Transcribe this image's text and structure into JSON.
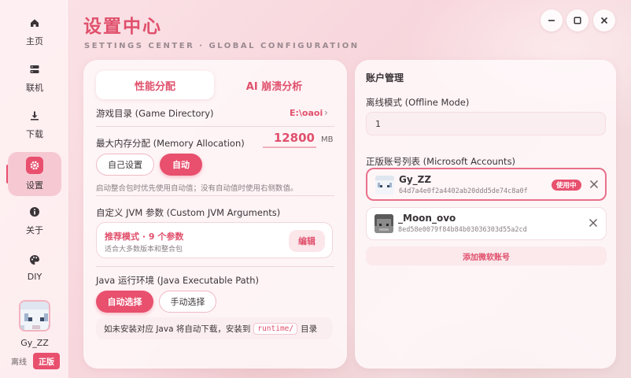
{
  "app": {
    "title": "设置中心",
    "subtitle": "SETTINGS CENTER · GLOBAL CONFIGURATION"
  },
  "sidebar": {
    "items": [
      {
        "label": "主页",
        "icon": "home-icon"
      },
      {
        "label": "联机",
        "icon": "server-icon"
      },
      {
        "label": "下载",
        "icon": "download-icon"
      },
      {
        "label": "设置",
        "icon": "gear-icon",
        "active": true
      },
      {
        "label": "关于",
        "icon": "info-icon"
      },
      {
        "label": "DIY",
        "icon": "palette-icon"
      }
    ],
    "user": {
      "name": "Gy_ZZ",
      "mode_offline": "离线",
      "mode_online": "正版"
    }
  },
  "left": {
    "tabs": [
      {
        "label": "性能分配",
        "active": true
      },
      {
        "label": "AI 崩溃分析",
        "active": false
      }
    ],
    "game_dir_label": "游戏目录 (Game Directory)",
    "game_dir_value": "E:\\oaoi",
    "memory_label": "最大内存分配 (Memory Allocation)",
    "memory_value": "12800",
    "memory_unit": "MB",
    "memory_custom": "自己设置",
    "memory_auto": "自动",
    "memory_hint": "启动整合包时优先使用自动值；没有自动值时使用右侧数值。",
    "jvm_label": "自定义 JVM 参数 (Custom JVM Arguments)",
    "jvm_mode": "推荐模式 · 9 个参数",
    "jvm_desc": "适合大多数版本和整合包",
    "jvm_edit": "编辑",
    "java_label": "Java 运行环境 (Java Executable Path)",
    "java_auto": "自动选择",
    "java_manual": "手动选择",
    "java_note_pre": "如未安装对应 Java 将自动下载，安装到",
    "java_note_code": "runtime/",
    "java_note_post": "目录"
  },
  "right": {
    "section_title": "账户管理",
    "offline_label": "离线模式 (Offline Mode)",
    "offline_value": "1",
    "ms_label": "正版账号列表 (Microsoft Accounts)",
    "accounts": [
      {
        "name": "Gy_ZZ",
        "uuid": "64d7a4e0f2a4402ab20ddd5de74c8a0f",
        "badge": "使用中",
        "selected": true
      },
      {
        "name": "_Moon_ovo",
        "uuid": "8ed58e0079f84b84b03036303d55a2cd",
        "badge": "",
        "selected": false
      }
    ],
    "add_account": "添加微软账号"
  },
  "colors": {
    "accent": "#e8506e",
    "title": "#e0506c",
    "background": "#f7d6dc"
  }
}
